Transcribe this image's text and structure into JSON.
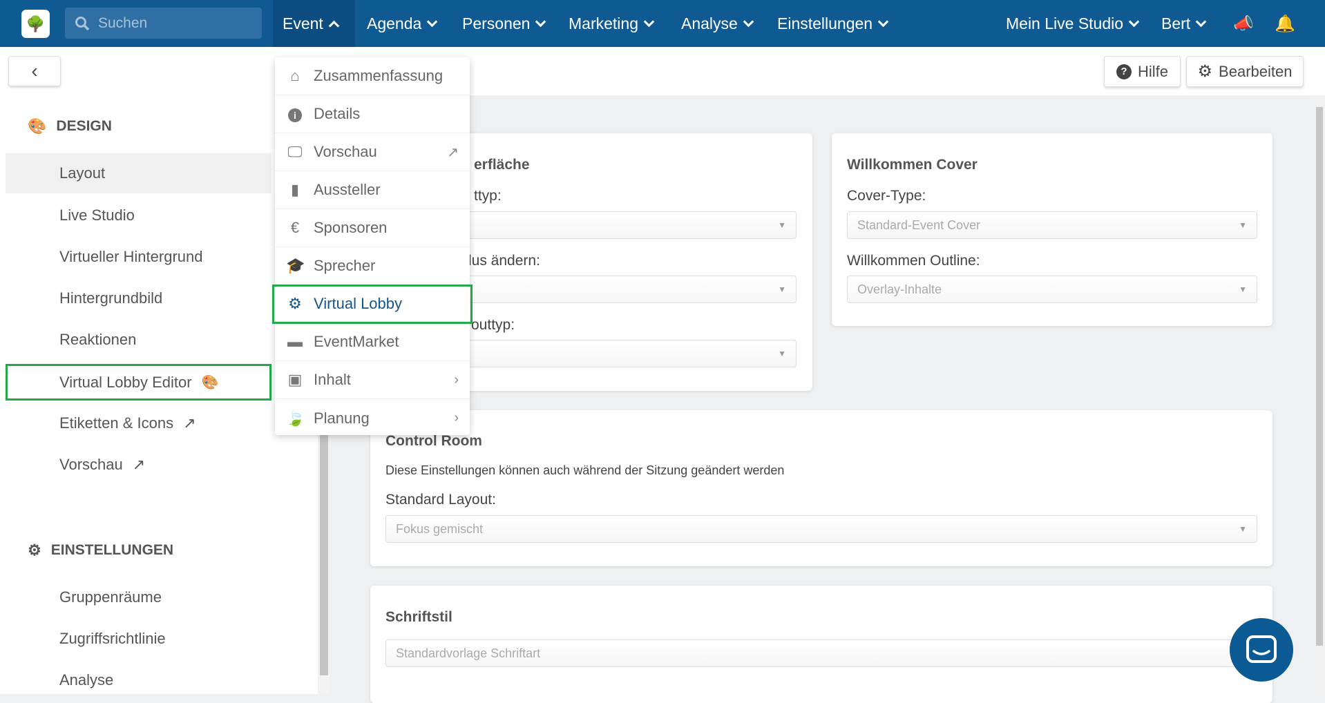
{
  "topbar": {
    "search_placeholder": "Suchen",
    "nav": [
      {
        "label": "Event",
        "open": true
      },
      {
        "label": "Agenda"
      },
      {
        "label": "Personen"
      },
      {
        "label": "Marketing"
      },
      {
        "label": "Analyse"
      },
      {
        "label": "Einstellungen"
      }
    ],
    "studio": "Mein Live Studio",
    "user": "Bert",
    "icons": [
      "megaphone-icon",
      "bell-icon"
    ],
    "color": "#105a94"
  },
  "header": {
    "help": "Hilfe",
    "edit": "Bearbeiten"
  },
  "sidebar": {
    "design_title": "DESIGN",
    "design_items": [
      {
        "label": "Layout",
        "selected": true
      },
      {
        "label": "Live Studio"
      },
      {
        "label": "Virtueller Hintergrund"
      },
      {
        "label": "Hintergrundbild"
      },
      {
        "label": "Reaktionen"
      },
      {
        "label": "Virtual Lobby Editor",
        "highlighted": true
      },
      {
        "label": "Etiketten & Icons"
      },
      {
        "label": "Vorschau"
      }
    ],
    "settings_title": "EINSTELLUNGEN",
    "settings_items": [
      {
        "label": "Gruppenräume"
      },
      {
        "label": "Zugriffsrichtlinie"
      },
      {
        "label": "Analyse"
      }
    ]
  },
  "event_menu": [
    {
      "label": "Zusammenfassung",
      "icon": "home-icon"
    },
    {
      "label": "Details",
      "icon": "info-icon"
    },
    {
      "label": "Vorschau",
      "icon": "monitor-icon"
    },
    {
      "label": "Aussteller",
      "icon": "booth-icon"
    },
    {
      "label": "Sponsoren",
      "icon": "euro-icon"
    },
    {
      "label": "Sprecher",
      "icon": "graduation-cap-icon"
    },
    {
      "label": "Virtual Lobby",
      "icon": "gears-icon",
      "highlighted": true
    },
    {
      "label": "EventMarket",
      "icon": "store-icon"
    },
    {
      "label": "Inhalt",
      "icon": "image-icon"
    },
    {
      "label": "Planung",
      "icon": "leaf-icon"
    }
  ],
  "card1": {
    "title": "erfläche",
    "label1": "ttyp:",
    "label2": "lus ändern:",
    "label3": "outtyp:"
  },
  "card2": {
    "title": "Willkommen Cover",
    "cover_label": "Cover-Type:",
    "cover_value": "Standard-Event Cover",
    "outline_label": "Willkommen Outline:",
    "outline_value": "Overlay-Inhalte"
  },
  "control_room": {
    "title": "Control Room",
    "desc": "Diese Einstellungen können auch während der Sitzung geändert werden",
    "layout_label": "Standard Layout:",
    "layout_value": "Fokus gemischt"
  },
  "font": {
    "title": "Schriftstil",
    "value": "Standardvorlage Schriftart"
  },
  "highlight_color": "#23a94a"
}
